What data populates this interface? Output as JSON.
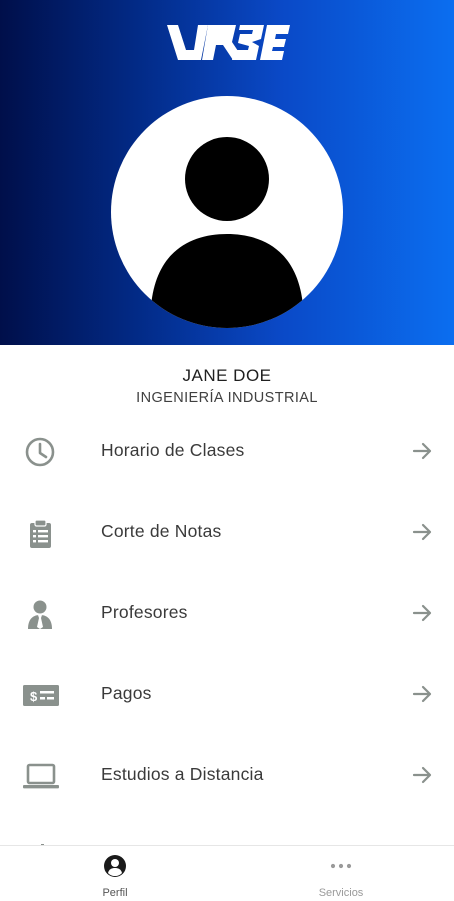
{
  "brand": {
    "logo_text": "URBE",
    "gradient_start": "#000f4a",
    "gradient_end": "#0b6ef0"
  },
  "profile": {
    "avatar_icon": "person-avatar-icon",
    "name": "JANE DOE",
    "career": "INGENIERÍA INDUSTRIAL"
  },
  "menu": {
    "items": [
      {
        "label": "Horario de Clases",
        "icon": "clock-icon"
      },
      {
        "label": "Corte de Notas",
        "icon": "clipboard-list-icon"
      },
      {
        "label": "Profesores",
        "icon": "teacher-icon"
      },
      {
        "label": "Pagos",
        "icon": "money-bill-icon"
      },
      {
        "label": "Estudios a Distancia",
        "icon": "laptop-icon"
      }
    ],
    "arrow_icon": "arrow-right-icon",
    "icon_color": "#8a918d"
  },
  "bottom_nav": {
    "tabs": [
      {
        "label": "Perfil",
        "icon": "person-circle-icon",
        "active": true
      },
      {
        "label": "Servicios",
        "icon": "more-horiz-icon",
        "active": false
      }
    ]
  }
}
